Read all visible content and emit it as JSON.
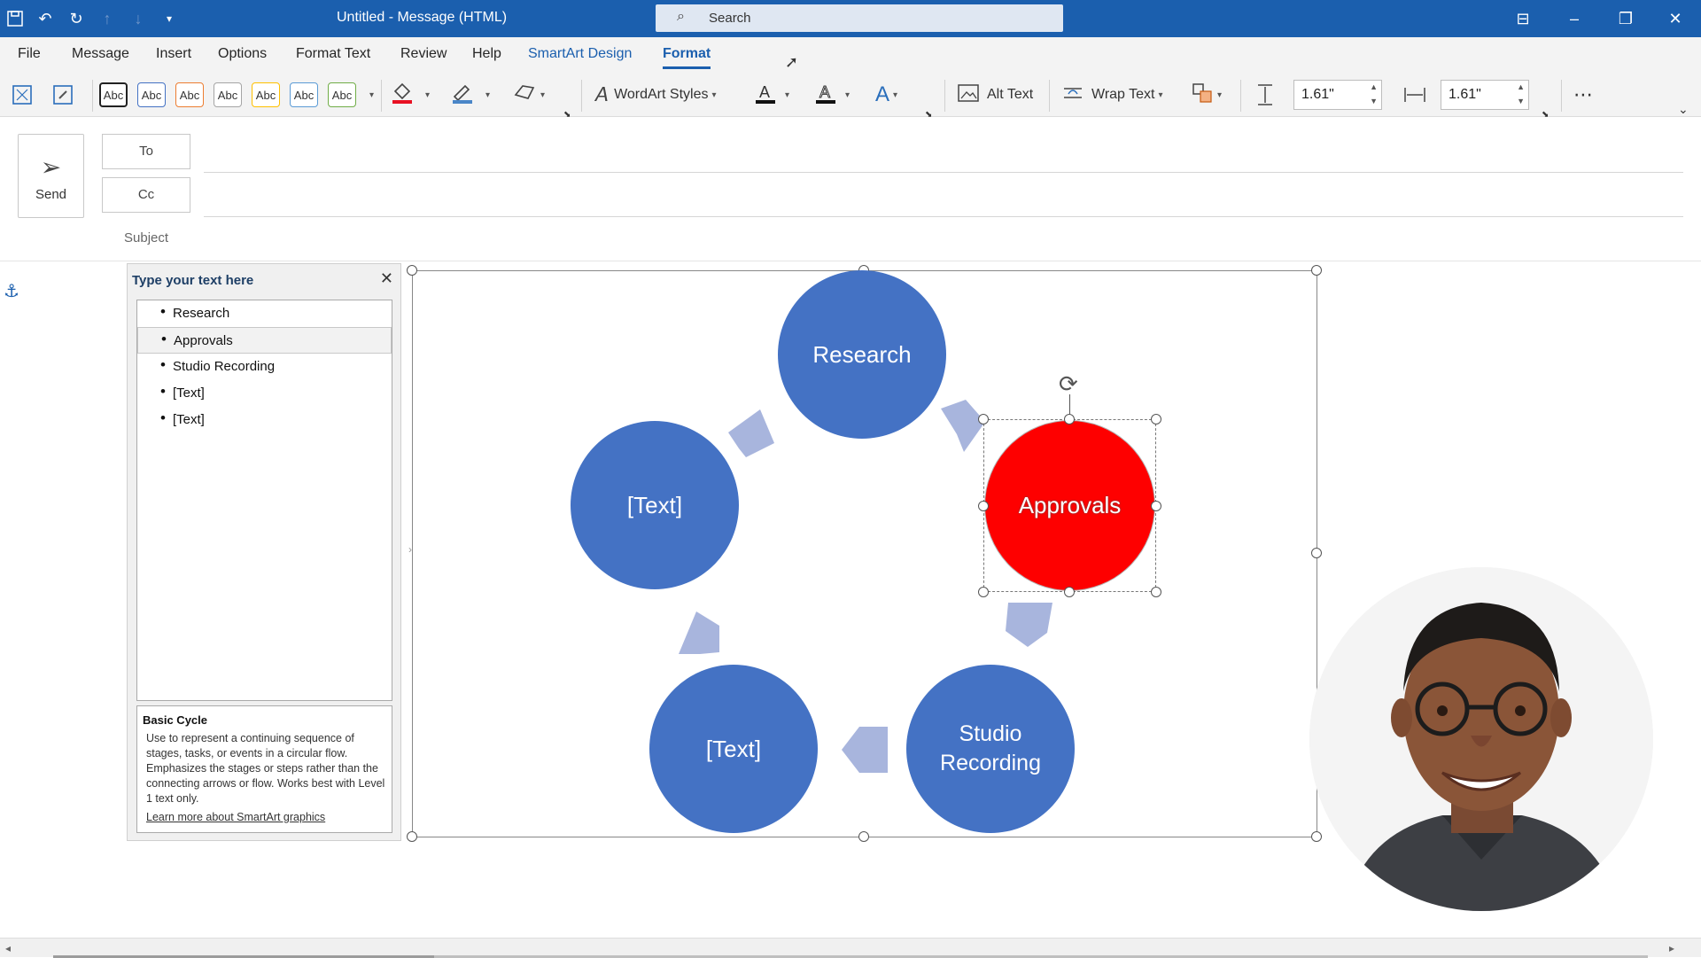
{
  "titlebar": {
    "title": "Untitled  -  Message (HTML)",
    "search_placeholder": "Search",
    "icons": [
      "save-icon",
      "undo-icon",
      "redo-icon",
      "up-arrow-icon",
      "down-arrow-icon",
      "customize-icon"
    ],
    "window_controls": [
      "ribbon-display-icon",
      "minimize-icon",
      "restore-icon",
      "close-icon"
    ]
  },
  "menu": {
    "items": [
      "File",
      "Message",
      "Insert",
      "Options",
      "Format Text",
      "Review",
      "Help"
    ],
    "contextual": [
      "SmartArt Design",
      "Format"
    ],
    "active": "Format"
  },
  "ribbon": {
    "shape_style_label": "Abc",
    "wordart_label": "WordArt Styles",
    "alt_text_label": "Alt Text",
    "wrap_text_label": "Wrap Text",
    "height_value": "1.61\"",
    "width_value": "1.61\""
  },
  "compose": {
    "send_label": "Send",
    "to_label": "To",
    "cc_label": "Cc",
    "subject_label": "Subject"
  },
  "text_pane": {
    "title": "Type your text here",
    "bullets": [
      "Research",
      "Approvals",
      "Studio Recording",
      "[Text]",
      "[Text]"
    ],
    "selected_index": 1,
    "desc_title": "Basic Cycle",
    "desc_text": "Use to represent a continuing sequence of stages, tasks, or events in a circular flow. Emphasizes the stages or steps rather than the connecting arrows or flow. Works best with Level 1 text only.",
    "learn_more": "Learn more about SmartArt graphics"
  },
  "smartart": {
    "layout": "Basic Cycle",
    "node_color": "#4472c4",
    "selected_color": "#fe0000",
    "arrow_color": "#a8b5dd",
    "nodes": [
      {
        "label": "Research"
      },
      {
        "label": "Approvals"
      },
      {
        "label": "Studio Recording"
      },
      {
        "label": "[Text]"
      },
      {
        "label": "[Text]"
      }
    ]
  },
  "colors": {
    "titlebar": "#1b5fae",
    "ribbon_bg": "#f3f3f3"
  }
}
